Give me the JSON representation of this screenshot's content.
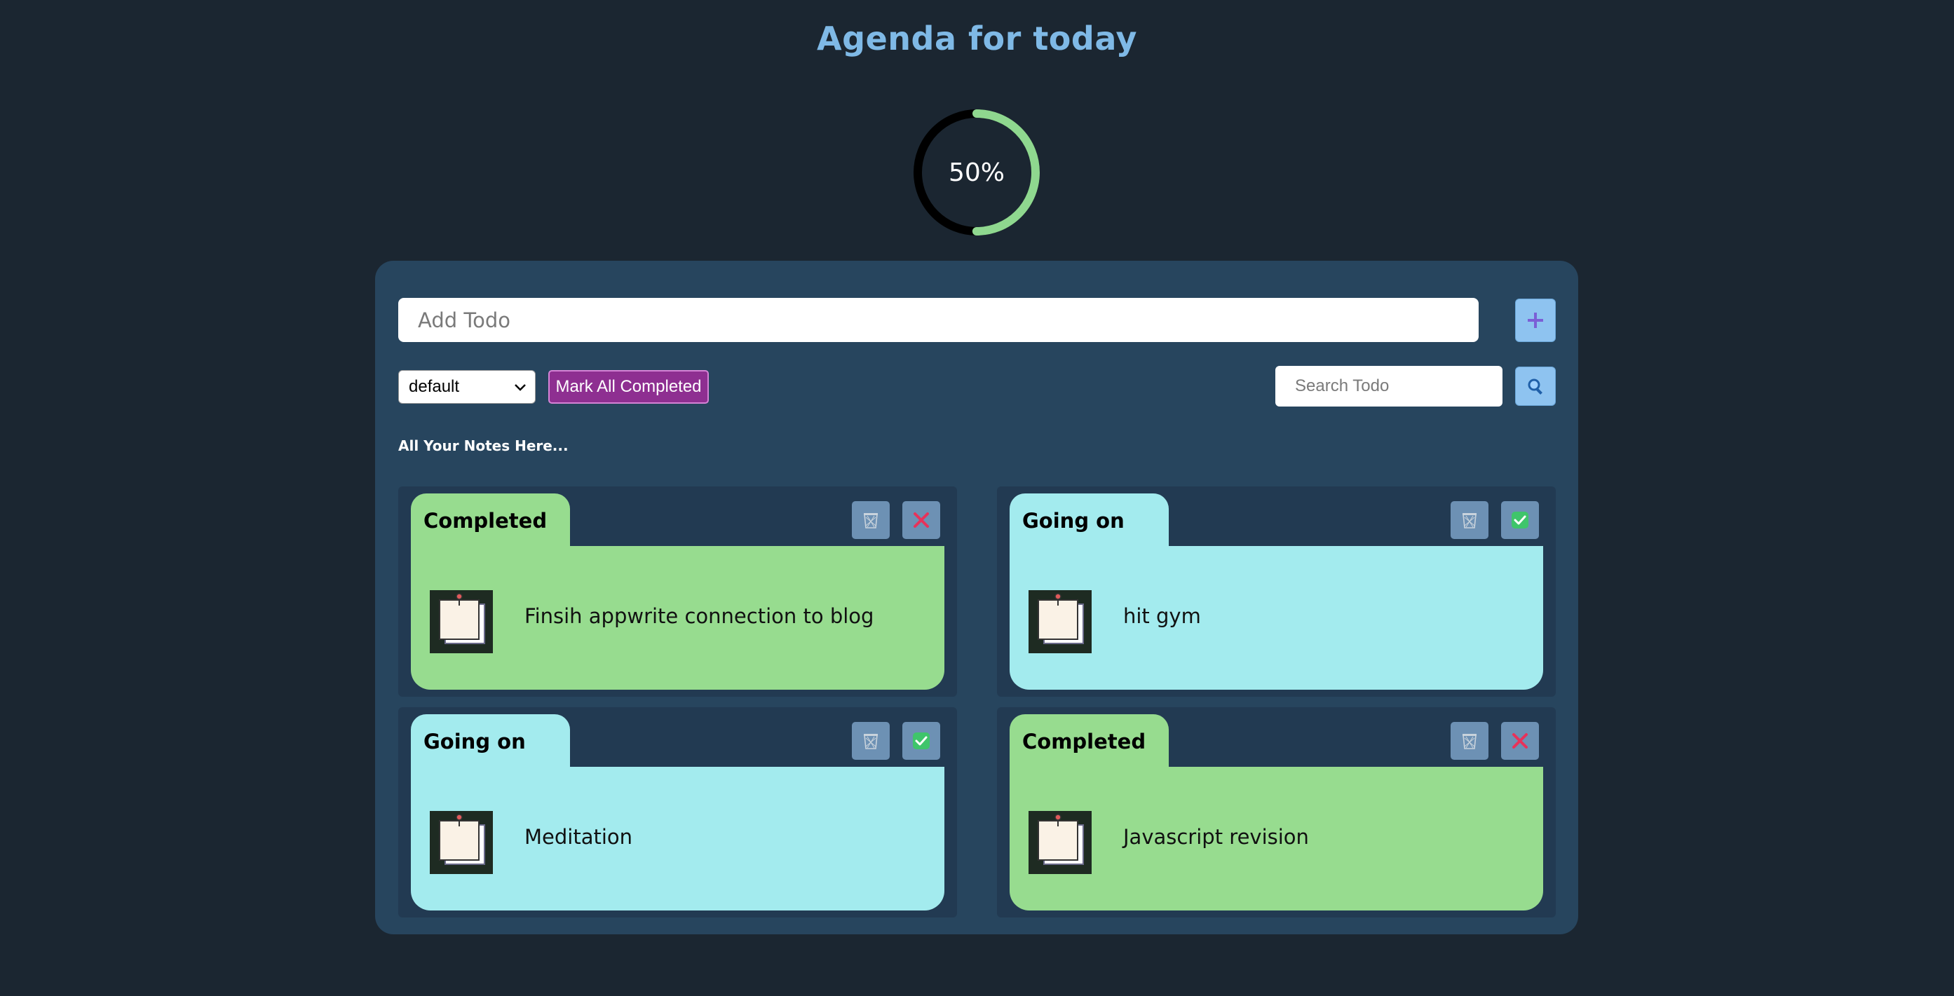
{
  "page_title": "Agenda for today",
  "progress": {
    "percent": 50,
    "label": "50%"
  },
  "colors": {
    "background": "#1b2631",
    "panel": "#27455e",
    "title": "#7fb9e6",
    "progress_done": "#8fd88f",
    "progress_rest": "#000000",
    "completed": "#97dc8f",
    "going_on": "#a3ebee",
    "mark_all": "#8e2f91"
  },
  "add_todo": {
    "placeholder": "Add Todo",
    "button_icon": "plus-icon"
  },
  "filter": {
    "selected": "default"
  },
  "mark_all_label": "Mark All Completed",
  "search": {
    "placeholder": "Search Todo",
    "button_icon": "magnifier-icon"
  },
  "notes_heading": "All Your Notes Here...",
  "todos": [
    {
      "status": "Completed",
      "text": "Finsih appwrite connection to blog",
      "action_icon": "x-icon"
    },
    {
      "status": "Going on",
      "text": "hit gym",
      "action_icon": "checkmark-icon"
    },
    {
      "status": "Going on",
      "text": "Meditation",
      "action_icon": "checkmark-icon"
    },
    {
      "status": "Completed",
      "text": "Javascript revision",
      "action_icon": "x-icon"
    }
  ]
}
